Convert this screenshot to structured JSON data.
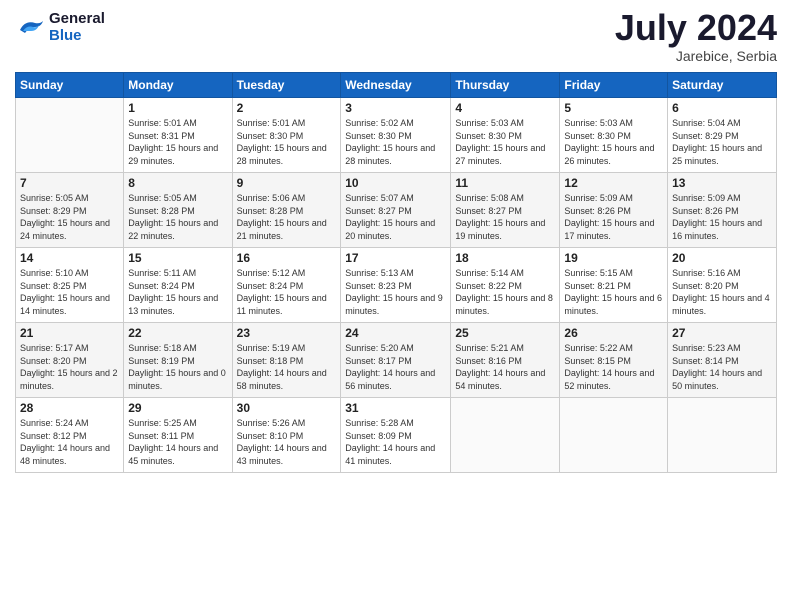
{
  "header": {
    "logo_line1": "General",
    "logo_line2": "Blue",
    "month_year": "July 2024",
    "location": "Jarebice, Serbia"
  },
  "days_of_week": [
    "Sunday",
    "Monday",
    "Tuesday",
    "Wednesday",
    "Thursday",
    "Friday",
    "Saturday"
  ],
  "weeks": [
    [
      {
        "day": "",
        "info": ""
      },
      {
        "day": "1",
        "info": "Sunrise: 5:01 AM\nSunset: 8:31 PM\nDaylight: 15 hours\nand 29 minutes."
      },
      {
        "day": "2",
        "info": "Sunrise: 5:01 AM\nSunset: 8:30 PM\nDaylight: 15 hours\nand 28 minutes."
      },
      {
        "day": "3",
        "info": "Sunrise: 5:02 AM\nSunset: 8:30 PM\nDaylight: 15 hours\nand 28 minutes."
      },
      {
        "day": "4",
        "info": "Sunrise: 5:03 AM\nSunset: 8:30 PM\nDaylight: 15 hours\nand 27 minutes."
      },
      {
        "day": "5",
        "info": "Sunrise: 5:03 AM\nSunset: 8:30 PM\nDaylight: 15 hours\nand 26 minutes."
      },
      {
        "day": "6",
        "info": "Sunrise: 5:04 AM\nSunset: 8:29 PM\nDaylight: 15 hours\nand 25 minutes."
      }
    ],
    [
      {
        "day": "7",
        "info": "Sunrise: 5:05 AM\nSunset: 8:29 PM\nDaylight: 15 hours\nand 24 minutes."
      },
      {
        "day": "8",
        "info": "Sunrise: 5:05 AM\nSunset: 8:28 PM\nDaylight: 15 hours\nand 22 minutes."
      },
      {
        "day": "9",
        "info": "Sunrise: 5:06 AM\nSunset: 8:28 PM\nDaylight: 15 hours\nand 21 minutes."
      },
      {
        "day": "10",
        "info": "Sunrise: 5:07 AM\nSunset: 8:27 PM\nDaylight: 15 hours\nand 20 minutes."
      },
      {
        "day": "11",
        "info": "Sunrise: 5:08 AM\nSunset: 8:27 PM\nDaylight: 15 hours\nand 19 minutes."
      },
      {
        "day": "12",
        "info": "Sunrise: 5:09 AM\nSunset: 8:26 PM\nDaylight: 15 hours\nand 17 minutes."
      },
      {
        "day": "13",
        "info": "Sunrise: 5:09 AM\nSunset: 8:26 PM\nDaylight: 15 hours\nand 16 minutes."
      }
    ],
    [
      {
        "day": "14",
        "info": "Sunrise: 5:10 AM\nSunset: 8:25 PM\nDaylight: 15 hours\nand 14 minutes."
      },
      {
        "day": "15",
        "info": "Sunrise: 5:11 AM\nSunset: 8:24 PM\nDaylight: 15 hours\nand 13 minutes."
      },
      {
        "day": "16",
        "info": "Sunrise: 5:12 AM\nSunset: 8:24 PM\nDaylight: 15 hours\nand 11 minutes."
      },
      {
        "day": "17",
        "info": "Sunrise: 5:13 AM\nSunset: 8:23 PM\nDaylight: 15 hours\nand 9 minutes."
      },
      {
        "day": "18",
        "info": "Sunrise: 5:14 AM\nSunset: 8:22 PM\nDaylight: 15 hours\nand 8 minutes."
      },
      {
        "day": "19",
        "info": "Sunrise: 5:15 AM\nSunset: 8:21 PM\nDaylight: 15 hours\nand 6 minutes."
      },
      {
        "day": "20",
        "info": "Sunrise: 5:16 AM\nSunset: 8:20 PM\nDaylight: 15 hours\nand 4 minutes."
      }
    ],
    [
      {
        "day": "21",
        "info": "Sunrise: 5:17 AM\nSunset: 8:20 PM\nDaylight: 15 hours\nand 2 minutes."
      },
      {
        "day": "22",
        "info": "Sunrise: 5:18 AM\nSunset: 8:19 PM\nDaylight: 15 hours\nand 0 minutes."
      },
      {
        "day": "23",
        "info": "Sunrise: 5:19 AM\nSunset: 8:18 PM\nDaylight: 14 hours\nand 58 minutes."
      },
      {
        "day": "24",
        "info": "Sunrise: 5:20 AM\nSunset: 8:17 PM\nDaylight: 14 hours\nand 56 minutes."
      },
      {
        "day": "25",
        "info": "Sunrise: 5:21 AM\nSunset: 8:16 PM\nDaylight: 14 hours\nand 54 minutes."
      },
      {
        "day": "26",
        "info": "Sunrise: 5:22 AM\nSunset: 8:15 PM\nDaylight: 14 hours\nand 52 minutes."
      },
      {
        "day": "27",
        "info": "Sunrise: 5:23 AM\nSunset: 8:14 PM\nDaylight: 14 hours\nand 50 minutes."
      }
    ],
    [
      {
        "day": "28",
        "info": "Sunrise: 5:24 AM\nSunset: 8:12 PM\nDaylight: 14 hours\nand 48 minutes."
      },
      {
        "day": "29",
        "info": "Sunrise: 5:25 AM\nSunset: 8:11 PM\nDaylight: 14 hours\nand 45 minutes."
      },
      {
        "day": "30",
        "info": "Sunrise: 5:26 AM\nSunset: 8:10 PM\nDaylight: 14 hours\nand 43 minutes."
      },
      {
        "day": "31",
        "info": "Sunrise: 5:28 AM\nSunset: 8:09 PM\nDaylight: 14 hours\nand 41 minutes."
      },
      {
        "day": "",
        "info": ""
      },
      {
        "day": "",
        "info": ""
      },
      {
        "day": "",
        "info": ""
      }
    ]
  ]
}
